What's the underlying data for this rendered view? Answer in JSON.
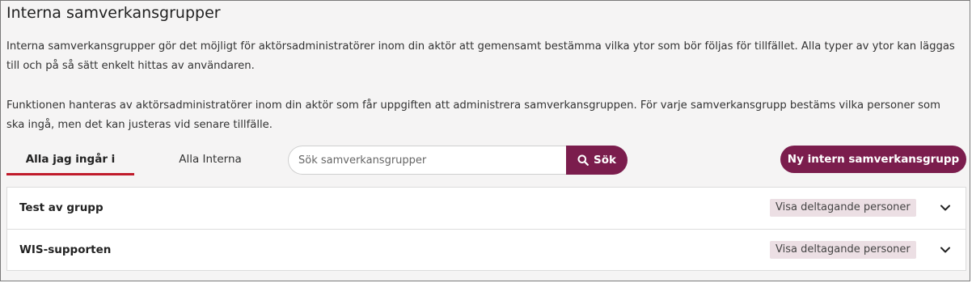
{
  "header": {
    "title": "Interna samverkansgrupper"
  },
  "intro": {
    "paragraph1": "Interna samverkansgrupper gör det möjligt för aktörsadministratörer inom din aktör att gemensamt bestämma vilka ytor som bör följas för tillfället. Alla typer av ytor kan läggas till och på så sätt enkelt hittas av användaren.",
    "paragraph2": "Funktionen hanteras av aktörsadministratörer inom din aktör som får uppgiften att administrera samverkansgruppen. För varje samverkansgrupp bestäms vilka personer som ska ingå, men det kan justeras vid senare tillfälle."
  },
  "tabs": [
    {
      "label": "Alla jag ingår i",
      "active": true
    },
    {
      "label": "Alla Interna",
      "active": false
    }
  ],
  "search": {
    "placeholder": "Sök samverkansgrupper",
    "value": "",
    "button_label": "Sök",
    "button_icon": "search-icon"
  },
  "actions": {
    "new_group_label": "Ny intern samverkansgrupp"
  },
  "groups": [
    {
      "name": "Test av grupp",
      "show_participants_label": "Visa deltagande personer",
      "expand_icon": "chevron-down-icon"
    },
    {
      "name": "WIS-supporten",
      "show_participants_label": "Visa deltagande personer",
      "expand_icon": "chevron-down-icon"
    }
  ],
  "colors": {
    "accent": "#7b1d4d",
    "active_tab_underline": "#c01a2a",
    "badge_background": "#ecdfe4",
    "page_background": "#f5f4f4"
  }
}
